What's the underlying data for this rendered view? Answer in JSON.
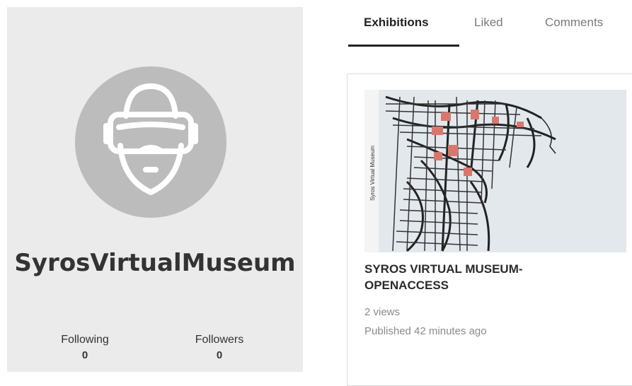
{
  "profile": {
    "username": "SyrosVirtualMuseum",
    "avatar_icon": "vr-headset-user-icon",
    "stats": [
      {
        "label": "Following",
        "value": "0"
      },
      {
        "label": "Followers",
        "value": "0"
      }
    ]
  },
  "tabs": [
    {
      "label": "Exhibitions",
      "active": true
    },
    {
      "label": "Liked",
      "active": false
    },
    {
      "label": "Comments",
      "active": false
    }
  ],
  "exhibition_card": {
    "image_icon": "syros-map-thumbnail",
    "title": "SYROS VIRTUAL MUSEUM-OPENACCESS",
    "views": "2 views",
    "published": "Published 42 minutes ago"
  }
}
